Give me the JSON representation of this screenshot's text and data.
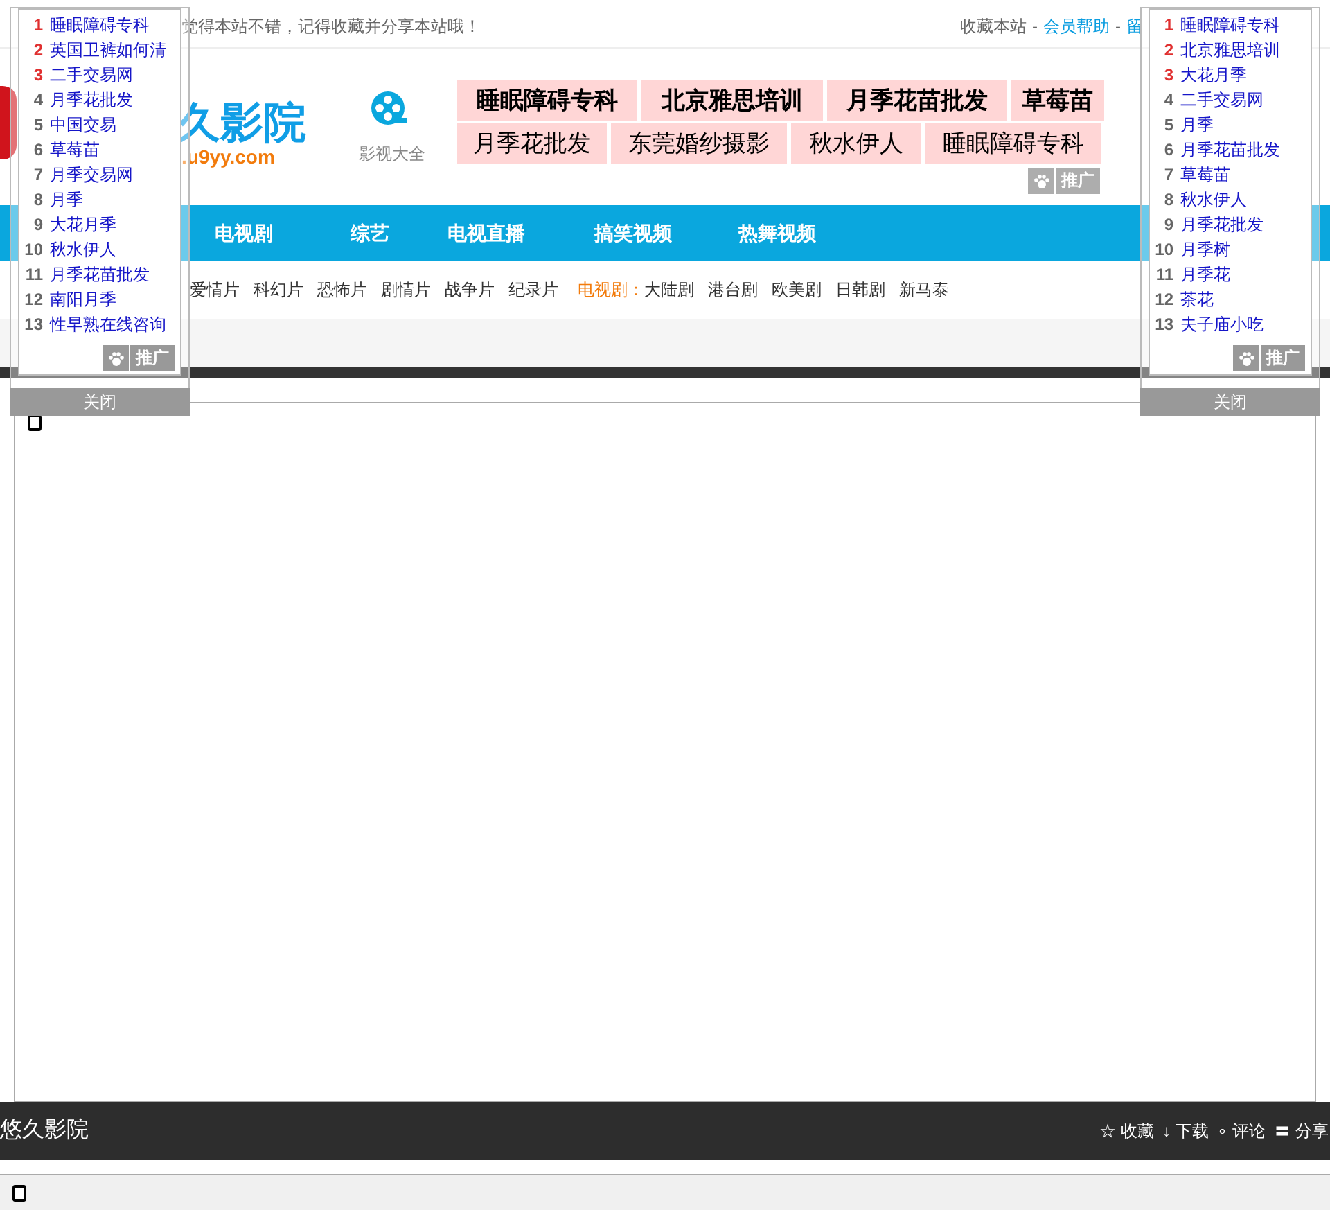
{
  "top_bar": {
    "notice": "觉得本站不错，记得收藏并分享本站哦！",
    "links": [
      {
        "label": "收藏本站",
        "kind": "plain"
      },
      {
        "label": "-",
        "kind": "sep"
      },
      {
        "label": "会员帮助",
        "kind": "link"
      },
      {
        "label": "-",
        "kind": "sep"
      },
      {
        "label": "留",
        "kind": "link"
      }
    ]
  },
  "header": {
    "logo_text": "久影院",
    "logo_url": ".u9yy.com",
    "app_label": "影视大全",
    "ads_row_1": [
      {
        "label": "睡眠障碍专科"
      },
      {
        "label": "北京雅思培训"
      },
      {
        "label": "月季花苗批发"
      },
      {
        "label": "草莓苗"
      }
    ],
    "ads_row_2": [
      {
        "label": "月季花批发"
      },
      {
        "label": "东莞婚纱摄影"
      },
      {
        "label": "秋水伊人"
      },
      {
        "label": "睡眠障碍专科"
      }
    ],
    "promo_badge": "推广"
  },
  "nav": [
    "电视剧",
    "综艺",
    "电视直播",
    "搞笑视频",
    "热舞视频"
  ],
  "sub_nav": {
    "movies": [
      "爱情片",
      "科幻片",
      "恐怖片",
      "剧情片",
      "战争片",
      "纪录片"
    ],
    "tv_label": "电视剧：",
    "tv": [
      "大陆剧",
      "港台剧",
      "欧美剧",
      "日韩剧",
      "新马泰"
    ]
  },
  "player_bar": {
    "title": "悠久影院",
    "actions": [
      {
        "icon": "☆",
        "label": "收藏"
      },
      {
        "icon": "↓",
        "label": "下载"
      },
      {
        "icon": "∘",
        "label": "评论"
      },
      {
        "icon": "〓",
        "label": "分享"
      }
    ]
  },
  "left_panel": {
    "items": [
      {
        "rank": "1",
        "label": "睡眠障碍专科",
        "hot": true
      },
      {
        "rank": "2",
        "label": "英国卫裤如何清",
        "hot": true
      },
      {
        "rank": "3",
        "label": "二手交易网",
        "hot": true
      },
      {
        "rank": "4",
        "label": "月季花批发",
        "hot": false
      },
      {
        "rank": "5",
        "label": "中国交易",
        "hot": false
      },
      {
        "rank": "6",
        "label": "草莓苗",
        "hot": false
      },
      {
        "rank": "7",
        "label": "月季交易网",
        "hot": false
      },
      {
        "rank": "8",
        "label": "月季",
        "hot": false
      },
      {
        "rank": "9",
        "label": "大花月季",
        "hot": false
      },
      {
        "rank": "10",
        "label": "秋水伊人",
        "hot": false
      },
      {
        "rank": "11",
        "label": "月季花苗批发",
        "hot": false
      },
      {
        "rank": "12",
        "label": "南阳月季",
        "hot": false
      },
      {
        "rank": "13",
        "label": "性早熟在线咨询",
        "hot": false
      }
    ],
    "promo_badge": "推广",
    "close": "关闭"
  },
  "right_panel": {
    "items": [
      {
        "rank": "1",
        "label": "睡眠障碍专科",
        "hot": true
      },
      {
        "rank": "2",
        "label": "北京雅思培训",
        "hot": true
      },
      {
        "rank": "3",
        "label": "大花月季",
        "hot": true
      },
      {
        "rank": "4",
        "label": "二手交易网",
        "hot": false
      },
      {
        "rank": "5",
        "label": "月季",
        "hot": false
      },
      {
        "rank": "6",
        "label": "月季花苗批发",
        "hot": false
      },
      {
        "rank": "7",
        "label": "草莓苗",
        "hot": false
      },
      {
        "rank": "8",
        "label": "秋水伊人",
        "hot": false
      },
      {
        "rank": "9",
        "label": "月季花批发",
        "hot": false
      },
      {
        "rank": "10",
        "label": "月季树",
        "hot": false
      },
      {
        "rank": "11",
        "label": "月季花",
        "hot": false
      },
      {
        "rank": "12",
        "label": "茶花",
        "hot": false
      },
      {
        "rank": "13",
        "label": "夫子庙小吃",
        "hot": false
      }
    ],
    "promo_badge": "推广",
    "close": "关闭"
  }
}
